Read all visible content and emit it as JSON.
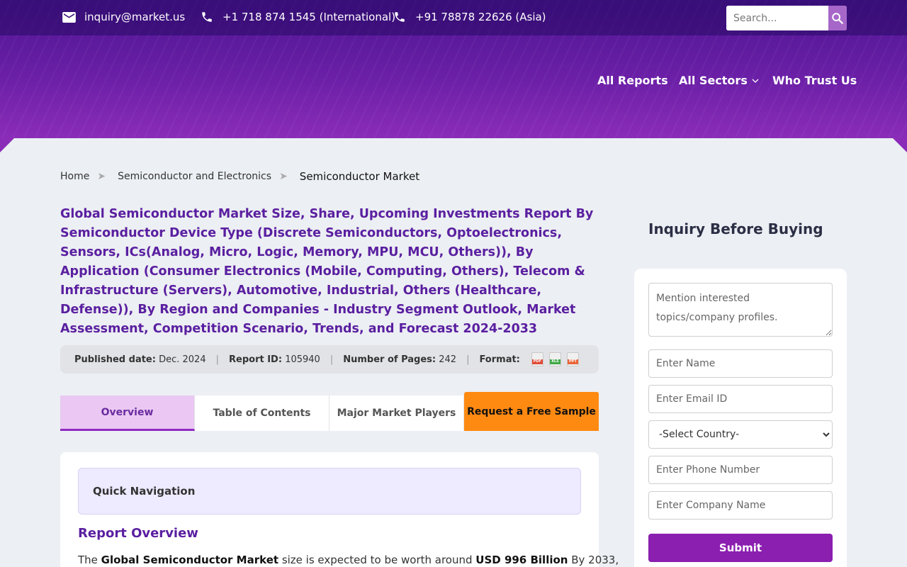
{
  "topbar": {
    "email": "inquiry@market.us",
    "phone_international": "+1 718 874 1545 (International)",
    "phone_asia": "+91 78878 22626 (Asia)",
    "search_placeholder": "Search...",
    "icons": {
      "email": "mail-icon",
      "phone": "phone-icon",
      "search": "search-icon"
    }
  },
  "nav": {
    "all_reports": "All Reports",
    "all_sectors": "All Sectors",
    "who_trust_us": "Who Trust Us"
  },
  "breadcrumb": {
    "home": "Home",
    "category": "Semiconductor and Electronics",
    "current": "Semiconductor Market"
  },
  "report": {
    "title": "Global Semiconductor Market Size, Share, Upcoming Investments Report By Semiconductor Device Type (Discrete Semiconductors, Optoelectronics, Sensors, ICs(Analog, Micro, Logic, Memory, MPU, MCU, Others)), By Application (Consumer Electronics (Mobile, Computing, Others), Telecom & Infrastructure (Servers), Automotive, Industrial, Others (Healthcare, Defense)), By Region and Companies - Industry Segment Outlook, Market Assessment, Competition Scenario, Trends, and Forecast 2024-2033",
    "published_label": "Published date:",
    "published_value": "Dec. 2024",
    "report_id_label": "Report ID:",
    "report_id_value": "105940",
    "pages_label": "Number of Pages:",
    "pages_value": "242",
    "format_label": "Format:",
    "formats": [
      "PDF",
      "XLS",
      "PPT"
    ]
  },
  "tabs": {
    "overview": "Overview",
    "toc": "Table of Contents",
    "players": "Major Market Players",
    "sample": "Request a Free Sample"
  },
  "content": {
    "quick_nav": "Quick Navigation",
    "overview_heading": "Report Overview",
    "overview_prefix": "The ",
    "overview_bold1": "Global Semiconductor Market",
    "overview_mid": " size is expected to be worth around ",
    "overview_bold2": "USD 996 Billion",
    "overview_suffix": " By 2033,"
  },
  "sidebar": {
    "heading": "Inquiry Before Buying",
    "topics_placeholder": "Mention interested topics/company profiles.",
    "name_placeholder": "Enter Name",
    "email_placeholder": "Enter Email ID",
    "country_selected": "-Select Country-",
    "phone_placeholder": "Enter Phone Number",
    "company_placeholder": "Enter Company Name",
    "submit": "Submit"
  },
  "colors": {
    "brand_purple": "#6a1fa6",
    "title_purple": "#5a1fa0",
    "cta_orange": "#ff8a12",
    "submit_purple": "#8b1fb0",
    "active_tab": "#eac8f3"
  }
}
